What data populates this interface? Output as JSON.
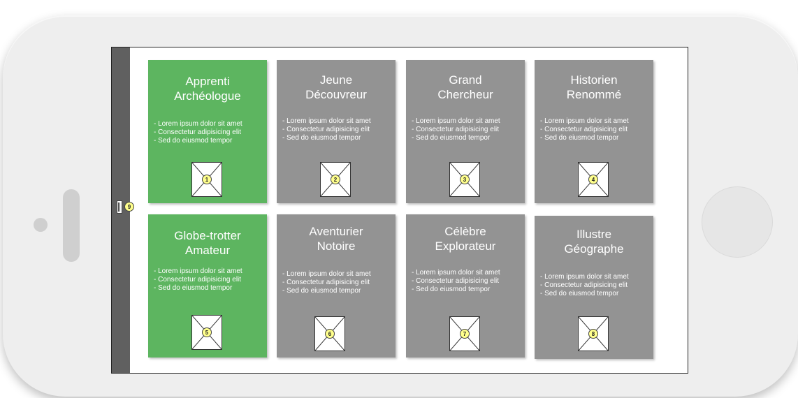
{
  "handle_badge": "9",
  "cards": [
    {
      "title_line1": "Apprenti",
      "title_line2": "Archéologue",
      "badge": "1",
      "state": "active",
      "items": [
        "- Lorem ipsum dolor sit amet",
        "- Consectetur adipisicing elit",
        "- Sed do eiusmod tempor"
      ]
    },
    {
      "title_line1": "Jeune",
      "title_line2": "Découvreur",
      "badge": "2",
      "state": "locked",
      "items": [
        "- Lorem ipsum dolor sit amet",
        "- Consectetur adipisicing elit",
        "- Sed do eiusmod tempor"
      ]
    },
    {
      "title_line1": "Grand",
      "title_line2": "Chercheur",
      "badge": "3",
      "state": "locked",
      "items": [
        "- Lorem ipsum dolor sit amet",
        "- Consectetur adipisicing elit",
        "- Sed do eiusmod tempor"
      ]
    },
    {
      "title_line1": "Historien",
      "title_line2": "Renommé",
      "badge": "4",
      "state": "locked",
      "items": [
        "- Lorem ipsum dolor sit amet",
        "- Consectetur adipisicing elit",
        "- Sed do eiusmod tempor"
      ]
    },
    {
      "title_line1": "Globe-trotter",
      "title_line2": "Amateur",
      "badge": "5",
      "state": "active",
      "items": [
        "- Lorem ipsum dolor sit amet",
        "- Consectetur adipisicing elit",
        "- Sed do eiusmod tempor"
      ]
    },
    {
      "title_line1": "Aventurier",
      "title_line2": "Notoire",
      "badge": "6",
      "state": "locked",
      "items": [
        "- Lorem ipsum dolor sit amet",
        "- Consectetur adipisicing elit",
        "- Sed do eiusmod tempor"
      ]
    },
    {
      "title_line1": "Célèbre",
      "title_line2": "Explorateur",
      "badge": "7",
      "state": "locked",
      "items": [
        "- Lorem ipsum dolor sit amet",
        "- Consectetur adipisicing elit",
        "- Sed do eiusmod tempor"
      ]
    },
    {
      "title_line1": "Illustre",
      "title_line2": "Géographe",
      "badge": "8",
      "state": "locked",
      "items": [
        "- Lorem ipsum dolor sit amet",
        "- Consectetur adipisicing elit",
        "- Sed do eiusmod tempor"
      ]
    }
  ],
  "colors": {
    "active": "#5db560",
    "locked": "#939393",
    "badge": "#ffff8c"
  },
  "icons": {
    "card_image": "image-placeholder-icon",
    "handle": "drag-handle-icon"
  }
}
